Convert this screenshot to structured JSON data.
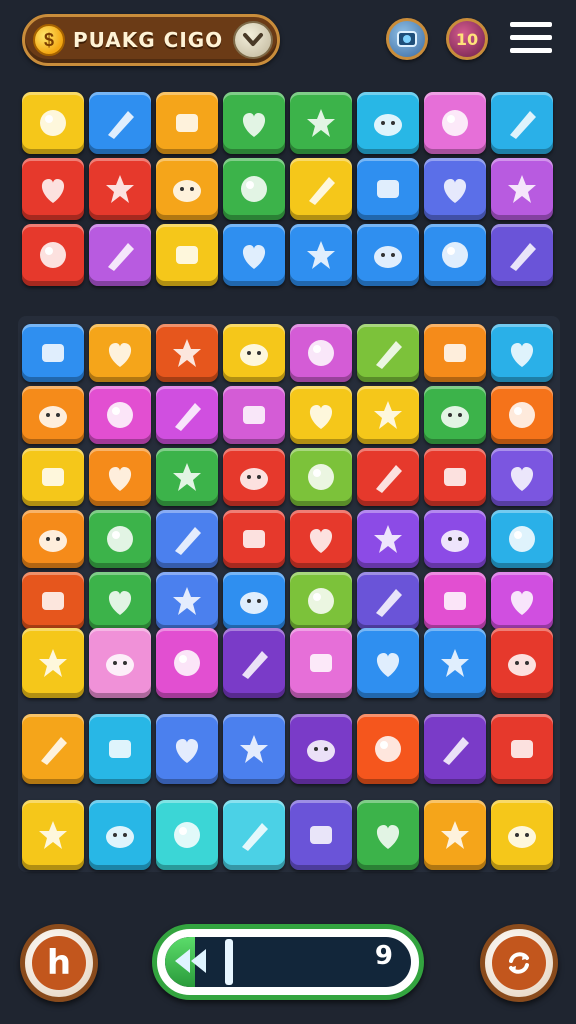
{
  "header": {
    "title": "PUAKG CIGO",
    "coin_symbol": "$",
    "badge_number": "10"
  },
  "board": {
    "rows_a": [
      [
        "#f5c71a",
        "#2f8ff0",
        "#f5a51a",
        "#3cb34a",
        "#3cb34a",
        "#28b7e6",
        "#e66fd8",
        "#2ab0e8"
      ],
      [
        "#e6392c",
        "#e6392c",
        "#f5a51a",
        "#3cb34a",
        "#f5c71a",
        "#2f8ff0",
        "#5b6fe8",
        "#b85be0"
      ],
      [
        "#e6392c",
        "#b85be0",
        "#f5c71a",
        "#2f8ff0",
        "#2f8ff0",
        "#2f8ff0",
        "#2f8ff0",
        "#6a54d8"
      ]
    ],
    "rows_b": [
      [
        "#2f8ff0",
        "#f5a51a",
        "#e6561d",
        "#f5c71a",
        "#d45cd6",
        "#7cc23a",
        "#f58b1a",
        "#2ab0e8"
      ],
      [
        "#f58b1a",
        "#e24fd1",
        "#d04fe0",
        "#d45cd6",
        "#f5c71a",
        "#f5c71a",
        "#3cb34a",
        "#f5731a"
      ],
      [
        "#f5c71a",
        "#f58b1a",
        "#3cb34a",
        "#e6392c",
        "#7cc23a",
        "#e6392c",
        "#e6392c",
        "#7b56e0"
      ],
      [
        "#f58b1a",
        "#3cb34a",
        "#4b80ee",
        "#e6392c",
        "#e6392c",
        "#8c4be6",
        "#8c4be6",
        "#2ab0e8"
      ],
      [
        "#e6561d",
        "#3cb34a",
        "#4b80ee",
        "#2f8ff0",
        "#7cc23a",
        "#6a54d8",
        "#e24fd1",
        "#d04fe0"
      ]
    ],
    "rows_c": [
      [
        "#f5c71a",
        "#f091d8",
        "#e24fd1",
        "#7a3bc8",
        "#e66fd8",
        "#2f8ff0",
        "#2f8ff0",
        "#e6392c"
      ],
      [
        "#f5a51a",
        "#28b7e6",
        "#4b80ee",
        "#4b80ee",
        "#7a3bc8",
        "#f5561d",
        "#7a3bc8",
        "#e6392c"
      ],
      [
        "#f5c71a",
        "#28b7e6",
        "#3bd6d6",
        "#4bd1e6",
        "#6a54d8",
        "#3cb34a",
        "#f5a51a",
        "#f5c71a"
      ]
    ]
  },
  "footer": {
    "left_label": "h",
    "progress_fraction": 0.12,
    "moves_count": "9"
  }
}
